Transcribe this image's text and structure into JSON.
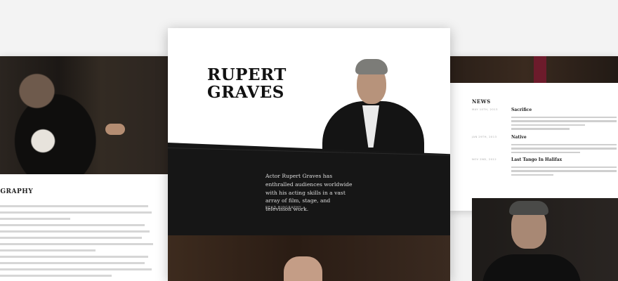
{
  "center": {
    "name_line1": "RUPERT",
    "name_line2": "GRAVES",
    "tagline": "Actor Rupert Graves has enthralled audiences worldwide with his acting skills in a vast array of film, stage, and television work.",
    "cta": "READ BIOGRAPHY ›"
  },
  "left": {
    "heading": "OGRAPHY"
  },
  "right": {
    "news_title": "NEWS",
    "items": [
      {
        "date": "MAY 10TH, 2013",
        "title": "Sacrifice"
      },
      {
        "date": "JAN 29TH, 2013",
        "title": "Native"
      },
      {
        "date": "NOV 2ND, 2012",
        "title": "Last Tango In Halifax"
      }
    ]
  },
  "colors": {
    "page_background": "#f3f3f3",
    "band": "#161616",
    "text_dark": "#111111"
  }
}
